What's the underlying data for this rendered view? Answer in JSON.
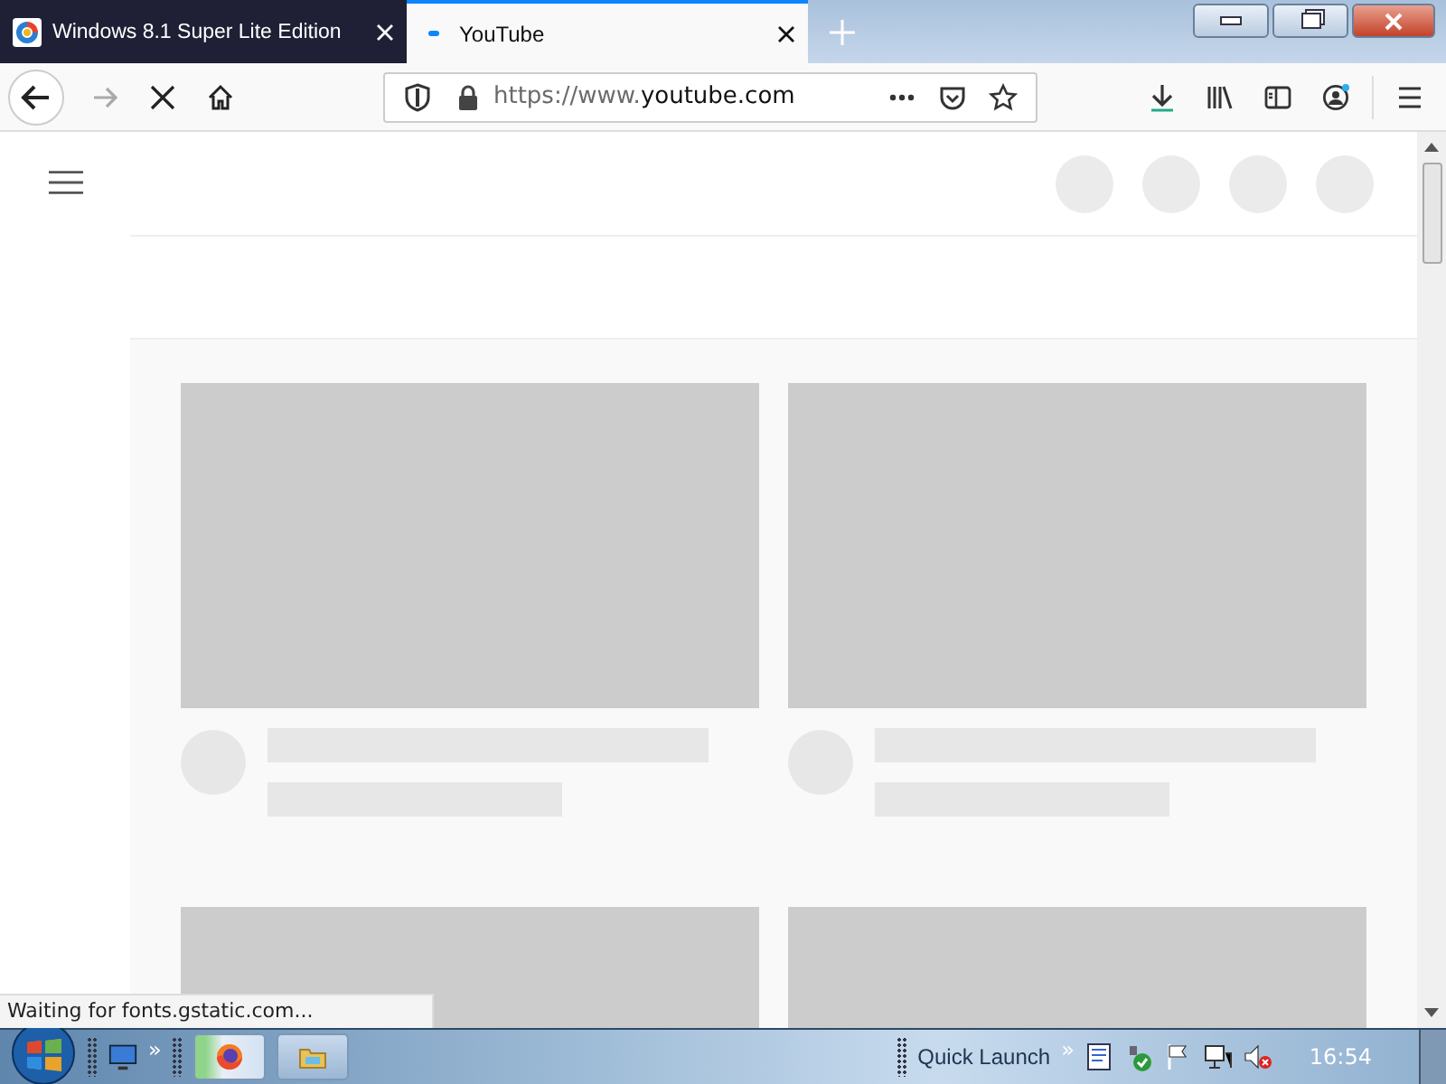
{
  "tabs": [
    {
      "title": "Windows 8.1 Super Lite Edition",
      "selected": false,
      "loading": false
    },
    {
      "title": "YouTube",
      "selected": true,
      "loading": true
    }
  ],
  "address_bar": {
    "url_scheme": "https://www.",
    "url_host": "youtube.com"
  },
  "status_text": "Waiting for fonts.gstatic.com...",
  "taskbar": {
    "quick_launch_label": "Quick Launch",
    "chevron": "»",
    "clock": "16:54",
    "buttons": [
      {
        "kind": "browser",
        "selected": true
      },
      {
        "kind": "folder",
        "selected": false
      }
    ]
  }
}
